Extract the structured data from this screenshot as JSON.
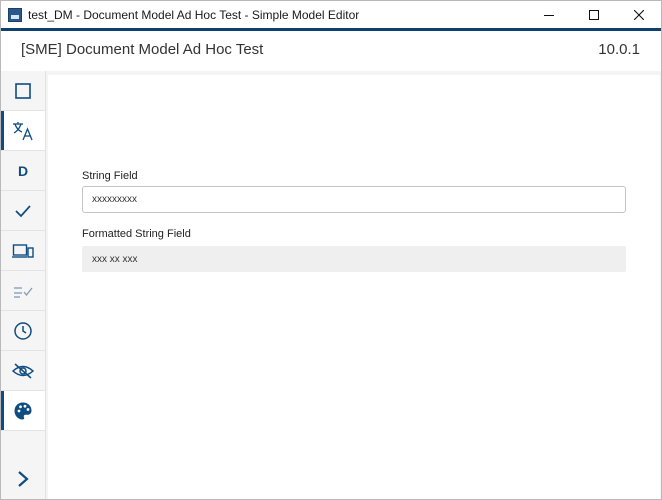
{
  "window": {
    "title": "test_DM - Document Model Ad Hoc Test - Simple Model Editor"
  },
  "header": {
    "title": "[SME] Document Model Ad Hoc Test",
    "version": "10.0.1"
  },
  "sidebar": {
    "items": [
      {
        "icon": "square-icon"
      },
      {
        "icon": "translate-icon"
      },
      {
        "icon": "d-letter-icon",
        "letter": "D"
      },
      {
        "icon": "check-icon"
      },
      {
        "icon": "devices-icon"
      },
      {
        "icon": "checklist-icon"
      },
      {
        "icon": "clock-icon"
      },
      {
        "icon": "eye-off-icon"
      },
      {
        "icon": "palette-icon"
      }
    ],
    "expand_icon": "chevron-right-icon"
  },
  "form": {
    "string_field": {
      "label": "String Field",
      "value": "xxxxxxxxx"
    },
    "formatted_string_field": {
      "label": "Formatted String Field",
      "value": "xxx xx xxx"
    }
  },
  "colors": {
    "accent": "#0f4c81",
    "title_accent": "#0f3f6c"
  }
}
